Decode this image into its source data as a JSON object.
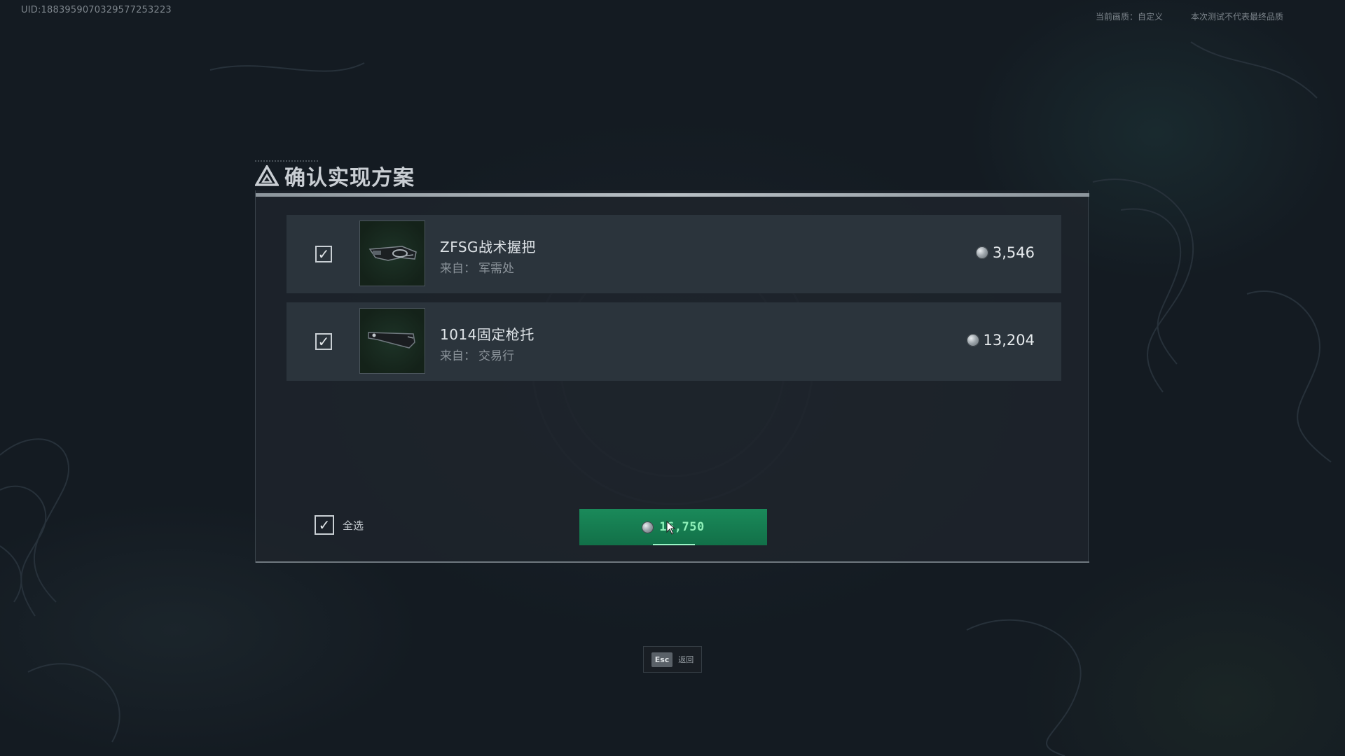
{
  "header": {
    "uid": "UID:1883959070329577253223",
    "quality_label": "当前画质：自定义",
    "test_notice": "本次测试不代表最终品质"
  },
  "dialog": {
    "title": "确认实现方案",
    "title_icon": "triangle-logo-icon",
    "items": [
      {
        "checked": true,
        "icon": "tactical-grip-icon",
        "name": "ZFSG战术握把",
        "source_prefix": "来自：",
        "source": "军需处",
        "price": "3,546"
      },
      {
        "checked": true,
        "icon": "fixed-stock-icon",
        "name": "1014固定枪托",
        "source_prefix": "来自：",
        "source": "交易行",
        "price": "13,204"
      }
    ],
    "select_all": {
      "checked": true,
      "label": "全选"
    },
    "confirm_button": {
      "total": "16,750"
    }
  },
  "footer": {
    "esc_key": "Esc",
    "esc_label": "返回"
  },
  "colors": {
    "background": "#141b22",
    "panel": "#1e252c",
    "row": "#2b343c",
    "confirm_green": "#127048",
    "confirm_text": "#8ef0b8"
  }
}
